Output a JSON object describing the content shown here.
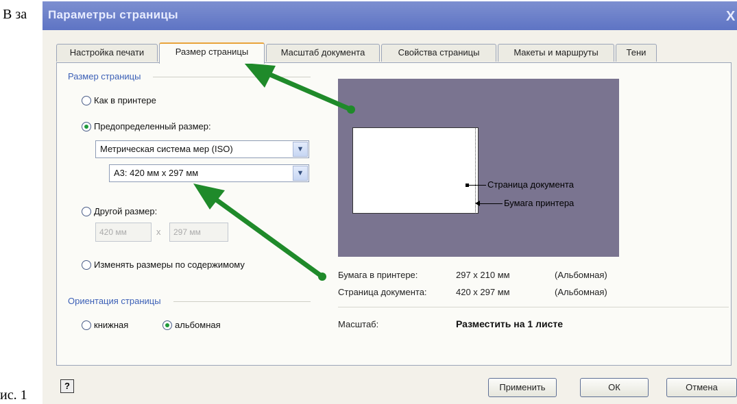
{
  "document": {
    "text_left": "В за",
    "caption": "ис. 1"
  },
  "dialog": {
    "title": "Параметры страницы",
    "close_glyph": "X",
    "tabs": [
      {
        "label": "Настройка печати"
      },
      {
        "label": "Размер страницы"
      },
      {
        "label": "Масштаб документа"
      },
      {
        "label": "Свойства страницы"
      },
      {
        "label": "Макеты и маршруты"
      },
      {
        "label": "Тени"
      }
    ],
    "active_tab": "Размер страницы",
    "page_size": {
      "group_title": "Размер страницы",
      "option_printer": "Как в принтере",
      "option_predefined": "Предопределенный размер:",
      "selected_option": "Предопределенный размер:",
      "system_select": "Метрическая система мер (ISO)",
      "size_select": "А3:  420 мм x 297 мм",
      "option_custom": "Другой размер:",
      "custom_width": "420 мм",
      "custom_sep": "x",
      "custom_height": "297 мм",
      "option_fit": "Изменять размеры по содержимому"
    },
    "orientation": {
      "group_title": "Ориентация страницы",
      "portrait": "книжная",
      "landscape": "альбомная",
      "selected": "альбомная"
    },
    "preview": {
      "page_label": "Страница документа",
      "paper_label": "Бумага принтера"
    },
    "info": {
      "printer_paper_label": "Бумага в принтере:",
      "printer_paper_size": "297 x 210 мм",
      "printer_paper_orient": "(Альбомная)",
      "doc_page_label": "Страница документа:",
      "doc_page_size": "420 x 297 мм",
      "doc_page_orient": "(Альбомная)",
      "scale_label": "Масштаб:",
      "scale_value": "Разместить на 1 листе"
    },
    "buttons": {
      "help": "?",
      "apply": "Применить",
      "ok": "ОК",
      "cancel": "Отмена"
    },
    "colors": {
      "arrow": "#1f8a2a",
      "title_bar": "#6b80c9",
      "preview_bg": "#7a7490"
    }
  }
}
